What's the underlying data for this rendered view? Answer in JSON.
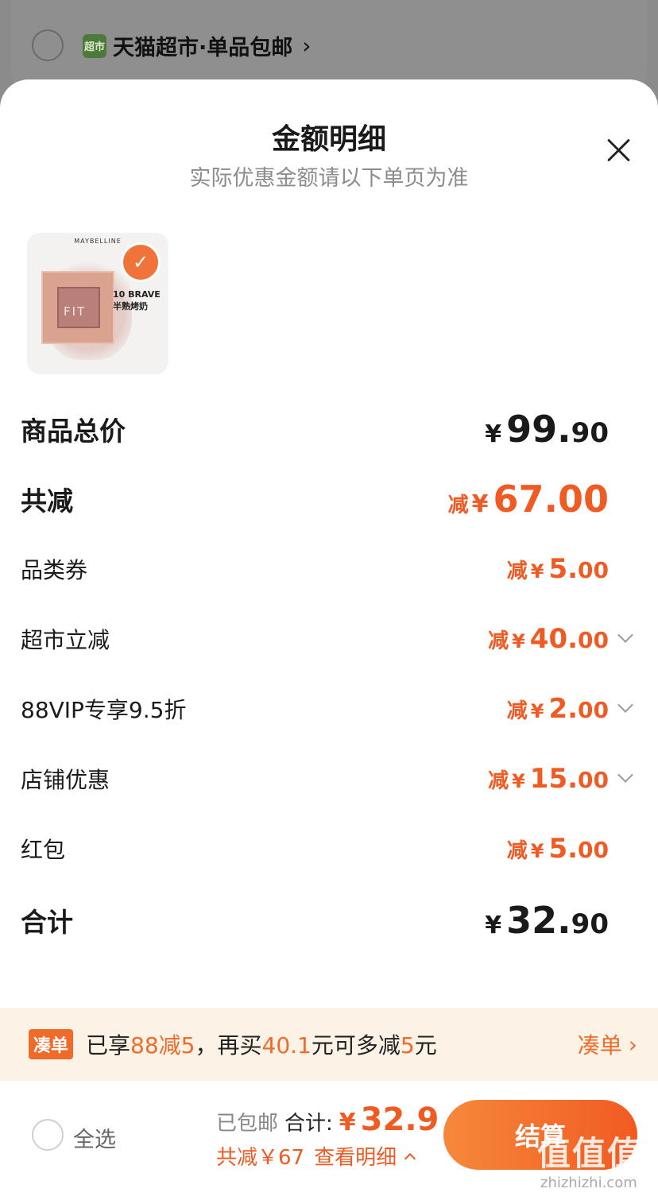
{
  "background": {
    "store_logo": "超市",
    "store_name": "天猫超市·单品包邮"
  },
  "sheet": {
    "title": "金额明细",
    "subtitle": "实际优惠金额请以下单页为准"
  },
  "product": {
    "brand": "MAYBELLINE",
    "label": "FIT",
    "shade_name": "10 BRAVE",
    "shade_desc": "半熟烤奶"
  },
  "rows": {
    "subtotal": {
      "label": "商品总价",
      "currency": "¥",
      "int": "99.",
      "dec": "90"
    },
    "total_discount": {
      "label": "共减",
      "prefix": "减",
      "currency": "¥",
      "int": "67.",
      "dec": "00"
    },
    "category_coupon": {
      "label": "品类券",
      "prefix": "减",
      "currency": "¥",
      "int": "5.",
      "dec": "00"
    },
    "supermarket": {
      "label": "超市立减",
      "prefix": "减",
      "currency": "¥",
      "int": "40.",
      "dec": "00"
    },
    "vip": {
      "label": "88VIP专享9.5折",
      "prefix": "减",
      "currency": "¥",
      "int": "2.",
      "dec": "00"
    },
    "store": {
      "label": "店铺优惠",
      "prefix": "减",
      "currency": "¥",
      "int": "15.",
      "dec": "00"
    },
    "red_packet": {
      "label": "红包",
      "prefix": "减",
      "currency": "¥",
      "int": "5.",
      "dec": "00"
    },
    "total": {
      "label": "合计",
      "currency": "¥",
      "int": "32.",
      "dec": "90"
    }
  },
  "promo": {
    "tag": "凑单",
    "t1": "已享",
    "t2": "88减5",
    "t3": "，再买",
    "t4": "40.1",
    "t5": "元可多减",
    "t6": "5",
    "t7": "元",
    "link": "凑单"
  },
  "bottom": {
    "select_all": "全选",
    "shipping": "已包邮",
    "total_label": "合计:",
    "currency": "¥",
    "total_value": "32.9",
    "discount_text": "共减￥67",
    "details_link": "查看明细",
    "checkout": "结算"
  },
  "watermark": {
    "main": "值值值",
    "sub": "zhizhizhi.com"
  },
  "colors": {
    "accent": "#f05a23",
    "promo_bg": "#fdf2e6"
  }
}
